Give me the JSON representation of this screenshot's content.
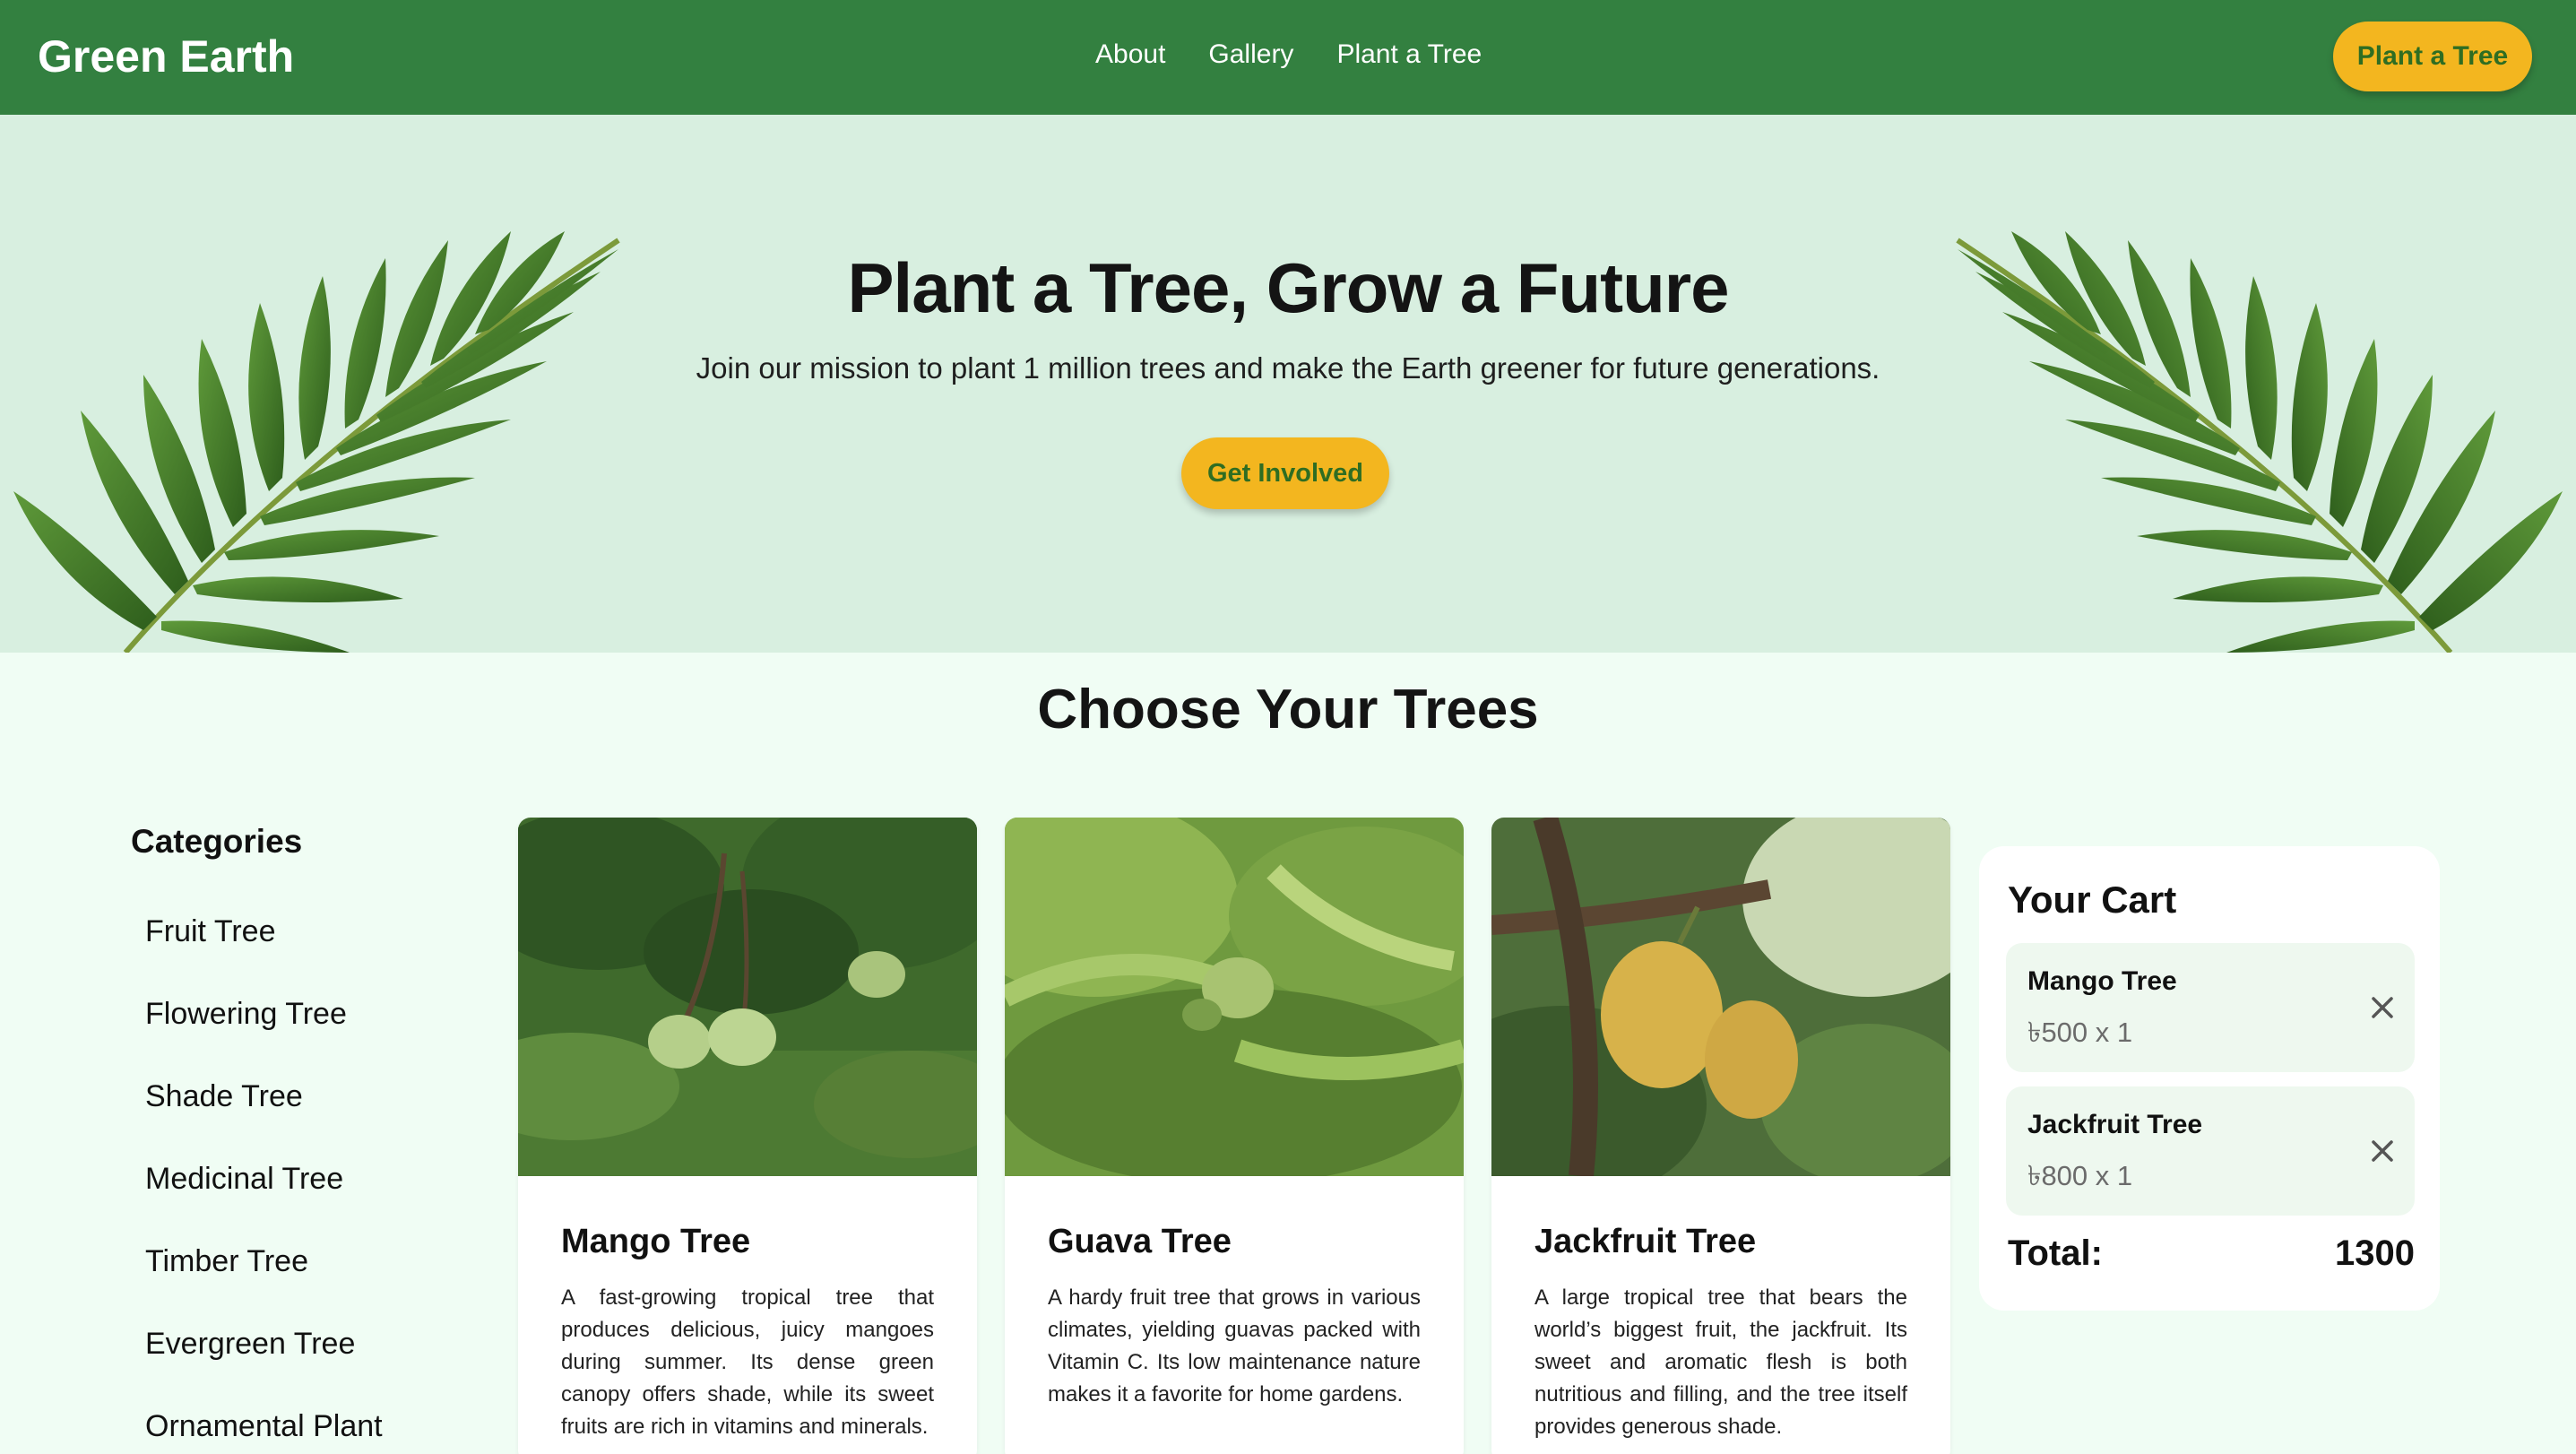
{
  "nav": {
    "brand": "Green Earth",
    "links": [
      "About",
      "Gallery",
      "Plant a Tree"
    ],
    "cta": "Plant a Tree"
  },
  "hero": {
    "title": "Plant a Tree, Grow a Future",
    "subtitle": "Join our mission to plant 1 million trees and make the Earth greener for future generations.",
    "cta": "Get Involved"
  },
  "section": {
    "title": "Choose Your Trees"
  },
  "categories": {
    "title": "Categories",
    "items": [
      "Fruit Tree",
      "Flowering Tree",
      "Shade Tree",
      "Medicinal Tree",
      "Timber Tree",
      "Evergreen Tree",
      "Ornamental Plant"
    ]
  },
  "trees": [
    {
      "name": "Mango Tree",
      "description": "A fast-growing tropical tree that produces delicious, juicy mangoes during summer. Its dense green canopy offers shade, while its sweet fruits are rich in vitamins and minerals."
    },
    {
      "name": "Guava Tree",
      "description": "A hardy fruit tree that grows in various climates, yielding guavas packed with Vitamin C. Its low maintenance nature makes it a favorite for home gardens."
    },
    {
      "name": "Jackfruit Tree",
      "description": "A large tropical tree that bears the world’s biggest fruit, the jackfruit. Its sweet and aromatic flesh is both nutritious and filling, and the tree itself provides generous shade."
    }
  ],
  "cart": {
    "title": "Your Cart",
    "items": [
      {
        "name": "Mango Tree",
        "price": "৳500 x 1"
      },
      {
        "name": "Jackfruit Tree",
        "price": "৳800 x 1"
      }
    ],
    "total_label": "Total:",
    "total_value": "1300"
  },
  "colors": {
    "nav": "#338040",
    "accent": "#f3b61f",
    "hero_bg": "#d8efe0",
    "page_bg": "#f0fdf4"
  }
}
